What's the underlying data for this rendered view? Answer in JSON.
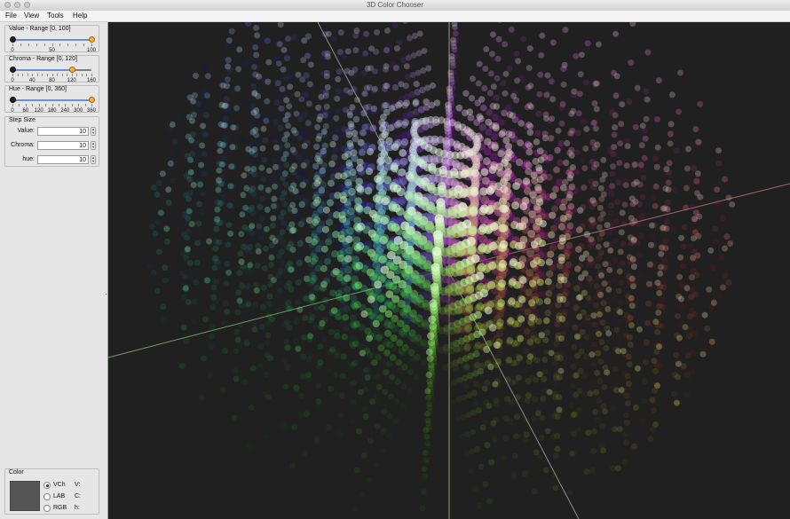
{
  "window": {
    "title": "3D Color Chooser"
  },
  "menu": {
    "items": [
      "File",
      "View",
      "Tools",
      "Help"
    ]
  },
  "sliders": [
    {
      "title": "Value - Range [0, 100]",
      "min": 0,
      "max": 100,
      "low": 0,
      "high": 100,
      "labels": [
        "0",
        "50",
        "100"
      ],
      "label_values": [
        0,
        50,
        100
      ],
      "ticks": 11
    },
    {
      "title": "Chroma - Range [0, 120]",
      "min": 0,
      "max": 160,
      "low": 0,
      "high": 120,
      "labels": [
        "0",
        "40",
        "80",
        "120",
        "160"
      ],
      "label_values": [
        0,
        40,
        80,
        120,
        160
      ],
      "ticks": 17
    },
    {
      "title": "Hue - Range [0, 360]",
      "min": 0,
      "max": 360,
      "low": 0,
      "high": 360,
      "labels": [
        "0",
        "60",
        "120",
        "180",
        "240",
        "300",
        "360"
      ],
      "label_values": [
        0,
        60,
        120,
        180,
        240,
        300,
        360
      ],
      "ticks": 13
    }
  ],
  "step_size": {
    "title": "Step Size",
    "rows": [
      {
        "label": "Value:",
        "value": "10"
      },
      {
        "label": "Chroma:",
        "value": "10"
      },
      {
        "label": "hue:",
        "value": "10"
      }
    ]
  },
  "color_panel": {
    "title": "Color",
    "swatch_color": "#555555",
    "modes": [
      {
        "label": "VCh",
        "selected": true,
        "component": "V:"
      },
      {
        "label": "LAB",
        "selected": false,
        "component": "C:"
      },
      {
        "label": "RGB",
        "selected": false,
        "component": "h:"
      }
    ]
  },
  "viewport": {
    "background": "#202020",
    "axis_colors": {
      "value_axis": "#c8c87a",
      "chroma_axis": "#aaa8a0",
      "hue_axis_green": "#8fd07f",
      "hue_axis_red": "#d48a90",
      "lower_axis": "#8898c0"
    }
  },
  "colors": {
    "accent_orange": "#f5b038",
    "slider_fill": "#6c8fcf"
  }
}
